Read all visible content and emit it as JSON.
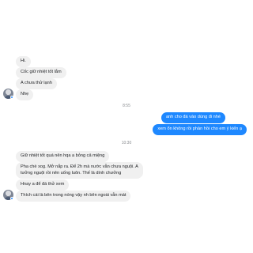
{
  "conversation": {
    "block1": {
      "messages": [
        "Hi.",
        "Cốc giữ nhiệt tốt lắm",
        "A chưa thử lạnh",
        "Nhẹ"
      ]
    },
    "timestamp1": "8:55",
    "outgoing": [
      "anh cho đá vào dùng đi nhé",
      "xem ổn không rồi phản hồi cho em ý kiến ạ"
    ],
    "timestamp2": "10:30",
    "block2": {
      "messages": [
        "Giữ nhiệt tốt quá nên hqa a bỏng cả miệng",
        "Pha chè xog. Mở nắp ra. Để 2h mà nước vẫn chưa nguội. A\ntưởng nguội rồi nên uống luôn. Thế là dính chưởng",
        "Hnay a để đá thử xem",
        "Thích cái là bên trong nóng vậy nh bên ngoài vẫn mát"
      ]
    },
    "colors": {
      "outgoing_bubble": "#1e88ff",
      "incoming_bubble": "#f0f0f0",
      "timestamp_text": "#8a8d91"
    }
  }
}
